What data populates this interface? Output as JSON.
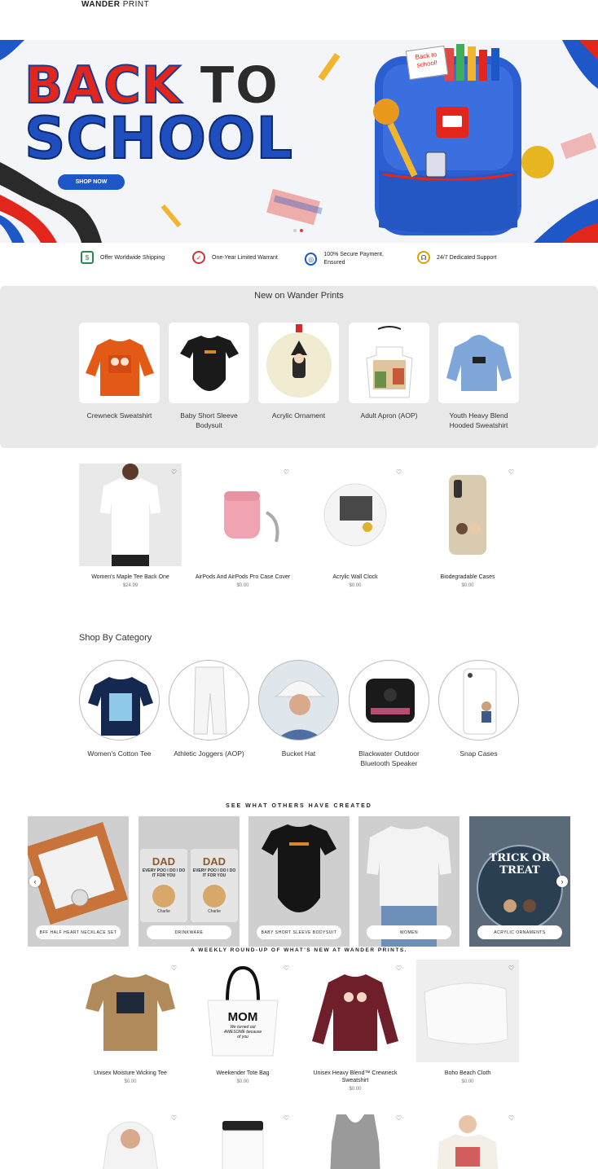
{
  "header": {
    "logo_bold": "WANDER",
    "logo_rest": " PRINT"
  },
  "hero": {
    "line1_a": "BACK",
    "line1_b": "TO",
    "line2": "SCHOOL",
    "cta": "SHOP NOW",
    "note_text": "Back to school!"
  },
  "features": [
    {
      "icon": "money-icon",
      "label": "Offer Worldwide Shipping"
    },
    {
      "icon": "warranty-badge-icon",
      "label": "One-Year Limited Warrant"
    },
    {
      "icon": "globe-icon",
      "label": "100% Secure Payment, Ensured"
    },
    {
      "icon": "headset-icon",
      "label": "24/7 Dedicated Support"
    }
  ],
  "new_section": {
    "title": "New on Wander Prints",
    "items": [
      {
        "label": "Crewneck Sweatshirt"
      },
      {
        "label": "Baby Short Sleeve Bodysuit"
      },
      {
        "label": "Acrylic Ornament"
      },
      {
        "label": "Adult Apron (AOP)"
      },
      {
        "label": "Youth Heavy Blend Hooded Sweatshirt"
      }
    ]
  },
  "products_row1": [
    {
      "name": "Women's Maple Tee Back One",
      "price": "$24.99"
    },
    {
      "name": "AirPods And AirPods Pro Case Cover",
      "price": "$0.00"
    },
    {
      "name": "Acrylic Wall Clock",
      "price": "$0.00"
    },
    {
      "name": "Biodegradable Cases",
      "price": "$0.00"
    }
  ],
  "category_section": {
    "title": "Shop By Category",
    "items": [
      {
        "label": "Women's Cotton Tee"
      },
      {
        "label": "Athletic Joggers (AOP)"
      },
      {
        "label": "Bucket Hat"
      },
      {
        "label": "Blackwater Outdoor Bluetooth Speaker"
      },
      {
        "label": "Snap Cases"
      }
    ]
  },
  "ugc_section": {
    "title": "SEE WHAT OTHERS HAVE CREATED",
    "items": [
      {
        "label": "BFF HALF HEART NECKLACE SET"
      },
      {
        "label": "DRINKWARE"
      },
      {
        "label": "BABY SHORT SLEEVE BODYSUIT"
      },
      {
        "label": "WOMEN"
      },
      {
        "label": "ACRYLIC ORNAMENTS"
      }
    ],
    "mug_text": "DAD",
    "mug_sub": "EVERY POO I DO I DO IT FOR YOU",
    "mug_name": "Charlie",
    "ornament_text": "TRICK OR TREAT",
    "prev": "‹",
    "next": "›"
  },
  "weekly": {
    "title": "A WEEKLY ROUND-UP OF WHAT'S NEW AT WANDER PRINTS.",
    "items": [
      {
        "name": "Unisex Moisture Wicking Tee",
        "price": "$0.00"
      },
      {
        "name": "Weekender Tote Bag",
        "price": "$0.00"
      },
      {
        "name": "Unisex Heavy Blend™ Crewneck Sweatshirt",
        "price": "$0.00"
      },
      {
        "name": "Boho Beach Cloth",
        "price": "$0.00"
      }
    ],
    "tote_big": "MOM",
    "tote_small": "We turned out AWESOME because of you"
  },
  "colors": {
    "brand_blue": "#1e57c7",
    "accent_red": "#e2261c",
    "panel_gray": "#e8e8e8"
  }
}
